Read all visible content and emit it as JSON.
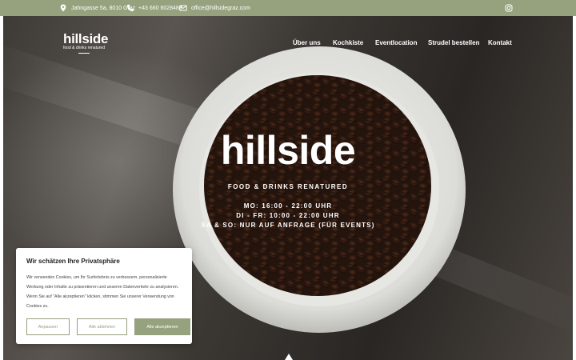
{
  "topbar": {
    "address": "Jahngasse 5a, 8010 Graz",
    "phone": "+43 660 6028488",
    "email": "office@hillsidegraz.com"
  },
  "brand": {
    "name": "hillside",
    "tagline": "food & drinks renatured"
  },
  "nav": {
    "items": [
      {
        "label": "Über uns"
      },
      {
        "label": "Kochkiste"
      },
      {
        "label": "Eventlocation"
      },
      {
        "label": "Strudel bestellen"
      },
      {
        "label": "Kontakt"
      }
    ]
  },
  "hero": {
    "title": "hillside",
    "subtitle": "FOOD & DRINKS RENATURED",
    "hours": [
      "MO: 16:00 - 22:00 UHR",
      "DI - FR: 10:00 - 22:00 UHR",
      "SA & SO: NUR AUF ANFRAGE (FÜR EVENTS)"
    ]
  },
  "cookie": {
    "title": "Wir schätzen Ihre Privatsphäre",
    "text": "Wir verwenden Cookies, um Ihr Surferlebnis zu verbessern, personalisierte Werbung oder Inhalte zu präsentieren und unseren Datenverkehr zu analysieren. Wenn Sie auf \"Alle akzeptieren\" klicken, stimmen Sie unserer Verwendung von Cookies zu.",
    "customize_label": "Anpassen",
    "reject_label": "Alle ablehnen",
    "accept_label": "Alle akzeptieren"
  },
  "colors": {
    "accent": "#96a17e"
  },
  "icons": [
    "location-icon",
    "phone-icon",
    "email-icon",
    "instagram-icon"
  ]
}
